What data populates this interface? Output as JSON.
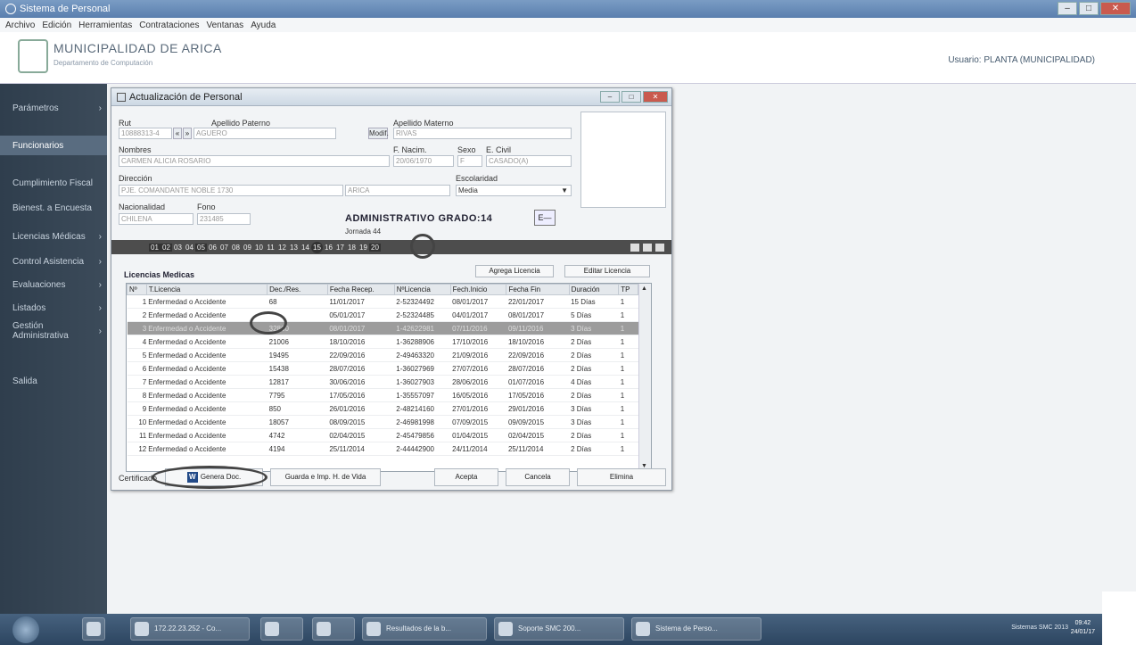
{
  "window": {
    "title": "Sistema de Personal",
    "controls": [
      "",
      "",
      ""
    ]
  },
  "menu": [
    "Archivo",
    "Edición",
    "Herramientas",
    "Contrataciones",
    "Ventanas",
    "Ayuda"
  ],
  "header": {
    "org": "MUNICIPALIDAD DE ARICA",
    "dept": "Departamento de Computación",
    "user": "Usuario: PLANTA (MUNICIPALIDAD)"
  },
  "sidebar": [
    {
      "label": "Parámetros",
      "chevron": "›",
      "active": false
    },
    {
      "label": "Funcionarios",
      "chevron": "",
      "active": true
    },
    {
      "label": "Cumplimiento Fiscal",
      "chevron": "",
      "active": false
    },
    {
      "label": "Bienest. a Encuesta",
      "chevron": "",
      "active": false
    },
    {
      "label": "Licencias Médicas",
      "chevron": "›",
      "active": false
    },
    {
      "label": "Control Asistencia",
      "chevron": "›",
      "active": false
    },
    {
      "label": "Evaluaciones",
      "chevron": "›",
      "active": false
    },
    {
      "label": "Listados",
      "chevron": "›",
      "active": false
    },
    {
      "label": "Gestión Administrativa",
      "chevron": "›",
      "active": false
    },
    {
      "label": "Salida",
      "chevron": "",
      "active": false
    }
  ],
  "dialog": {
    "title": "Actualización de Personal",
    "rut_label": "Rut",
    "rut_value": "10888313-4",
    "apellido_paterno_label": "Apellido Paterno",
    "apellido_paterno_value": "AGUERO",
    "apellido_materno_label": "Apellido Materno",
    "apellido_materno_value": "RIVAS",
    "modif_label": "Modif.",
    "nombres_label": "Nombres",
    "nombres_value": "CARMEN ALICIA ROSARIO",
    "f_nacim_label": "F. Nacim.",
    "f_nacim_value": "20/06/1970",
    "sexo_label": "Sexo",
    "sexo_value": "F",
    "e_civil_label": "E. Civil",
    "e_civil_value": "CASADO(A)",
    "direccion_label": "Dirección",
    "direccion_value": "PJE. COMANDANTE NOBLE 1730",
    "comuna_value": "ARICA",
    "escolaridad_label": "Escolaridad",
    "escolaridad_value": "Media",
    "nacionalidad_label": "Nacionalidad",
    "nacionalidad_value": "CHILENA",
    "fono_label": "Fono",
    "fono_value": "231485",
    "category": "ADMINISTRATIVO  GRADO:14",
    "jornada": "Jornada 44",
    "ed_btn": "E—",
    "tabs": [
      {
        "label": "",
        "style": ""
      },
      {
        "label": "",
        "style": ""
      },
      {
        "label": "01",
        "style": "dark"
      },
      {
        "label": "02",
        "style": "dark"
      },
      {
        "label": "03",
        "style": ""
      },
      {
        "label": "04",
        "style": ""
      },
      {
        "label": "05",
        "style": "dark"
      },
      {
        "label": "06",
        "style": ""
      },
      {
        "label": "07",
        "style": ""
      },
      {
        "label": "08",
        "style": ""
      },
      {
        "label": "09",
        "style": ""
      },
      {
        "label": "10",
        "style": ""
      },
      {
        "label": "11",
        "style": ""
      },
      {
        "label": "12",
        "style": ""
      },
      {
        "label": "13",
        "style": ""
      },
      {
        "label": "14",
        "style": ""
      },
      {
        "label": "15",
        "style": "selected"
      },
      {
        "label": "16",
        "style": ""
      },
      {
        "label": "17",
        "style": ""
      },
      {
        "label": "18",
        "style": ""
      },
      {
        "label": "19",
        "style": ""
      },
      {
        "label": "20",
        "style": "dark"
      }
    ],
    "section_title": "Licencias Medicas",
    "agrega_btn": "Agrega Licencia",
    "editar_btn": "Editar Licencia",
    "columns": [
      "Nº",
      "T.Licencia",
      "Dec./Res.",
      "Fecha Recep.",
      "NºLicencia",
      "Fech.Inicio",
      "Fecha Fin",
      "Duración",
      "TP"
    ],
    "rows": [
      [
        "1",
        "Enfermedad o Accidente",
        "68",
        "11/01/2017",
        "2-52324492",
        "08/01/2017",
        "22/01/2017",
        "15 Días",
        "1"
      ],
      [
        "2",
        "Enfermedad o Accidente",
        "",
        "05/01/2017",
        "2-52324485",
        "04/01/2017",
        "08/01/2017",
        "5 Días",
        "1"
      ],
      [
        "3",
        "Enfermedad o Accidente",
        "32860",
        "08/01/2017",
        "1-42622981",
        "07/11/2016",
        "09/11/2016",
        "3 Días",
        "1"
      ],
      [
        "4",
        "Enfermedad o Accidente",
        "21006",
        "18/10/2016",
        "1-36288906",
        "17/10/2016",
        "18/10/2016",
        "2 Días",
        "1"
      ],
      [
        "5",
        "Enfermedad o Accidente",
        "19495",
        "22/09/2016",
        "2-49463320",
        "21/09/2016",
        "22/09/2016",
        "2 Días",
        "1"
      ],
      [
        "6",
        "Enfermedad o Accidente",
        "15438",
        "28/07/2016",
        "1-36027969",
        "27/07/2016",
        "28/07/2016",
        "2 Días",
        "1"
      ],
      [
        "7",
        "Enfermedad o Accidente",
        "12817",
        "30/06/2016",
        "1-36027903",
        "28/06/2016",
        "01/07/2016",
        "4 Días",
        "1"
      ],
      [
        "8",
        "Enfermedad o Accidente",
        "7795",
        "17/05/2016",
        "1-35557097",
        "16/05/2016",
        "17/05/2016",
        "2 Días",
        "1"
      ],
      [
        "9",
        "Enfermedad o Accidente",
        "850",
        "26/01/2016",
        "2-48214160",
        "27/01/2016",
        "29/01/2016",
        "3 Días",
        "1"
      ],
      [
        "10",
        "Enfermedad o Accidente",
        "18057",
        "08/09/2015",
        "2-46981998",
        "07/09/2015",
        "09/09/2015",
        "3 Días",
        "1"
      ],
      [
        "11",
        "Enfermedad o Accidente",
        "4742",
        "02/04/2015",
        "2-45479856",
        "01/04/2015",
        "02/04/2015",
        "2 Días",
        "1"
      ],
      [
        "12",
        "Enfermedad o Accidente",
        "4194",
        "25/11/2014",
        "2-44442900",
        "24/11/2014",
        "25/11/2014",
        "2 Días",
        "1"
      ]
    ],
    "selected_row": 2,
    "certificado_label": "Certificado",
    "word_icon": "W",
    "genera_btn": "Genera Doc.",
    "guarda_btn": "Guarda e Imp. H. de Vida",
    "acepta_btn": "Acepta",
    "cancela_btn": "Cancela",
    "elimina_btn": "Elimina"
  },
  "taskbar": {
    "items": [
      "172.22.23.252 - Co...",
      "",
      "",
      "Resultados de la b...",
      "Soporte SMC 200...",
      "Sistema de Perso..."
    ],
    "tray": "Sistemas SMC 2013",
    "time": "09:42",
    "date": "24/01/17"
  }
}
